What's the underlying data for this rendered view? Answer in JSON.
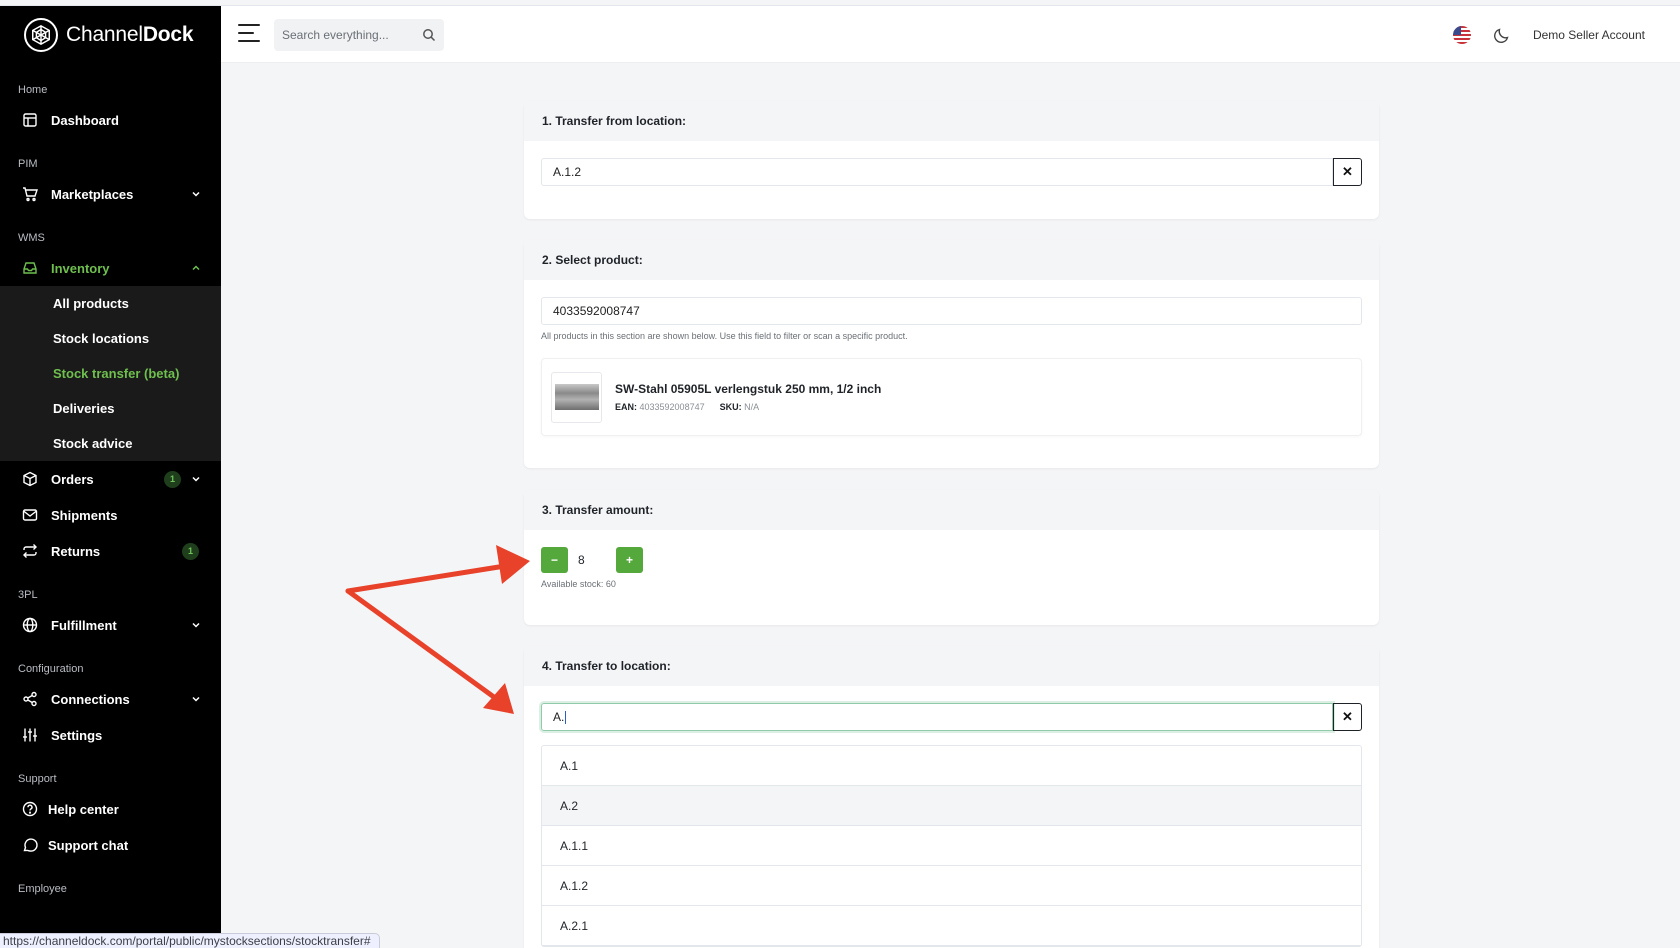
{
  "brand": {
    "name_part1": "Channel",
    "name_part2": "Dock"
  },
  "sidebar": {
    "sections": {
      "home": "Home",
      "pim": "PIM",
      "wms": "WMS",
      "tpl": "3PL",
      "config": "Configuration",
      "support": "Support",
      "employee": "Employee"
    },
    "dashboard": "Dashboard",
    "marketplaces": "Marketplaces",
    "inventory": "Inventory",
    "inventory_sub": [
      "All products",
      "Stock locations",
      "Stock transfer (beta)",
      "Deliveries",
      "Stock advice"
    ],
    "orders": "Orders",
    "orders_badge": "1",
    "shipments": "Shipments",
    "returns": "Returns",
    "returns_badge": "1",
    "fulfillment": "Fulfillment",
    "connections": "Connections",
    "settings": "Settings",
    "help_center": "Help center",
    "support_chat": "Support chat"
  },
  "header": {
    "search_placeholder": "Search everything...",
    "account": "Demo Seller Account"
  },
  "step1": {
    "title": "1. Transfer from location:",
    "value": "A.1.2",
    "clear": "✕"
  },
  "step2": {
    "title": "2. Select product:",
    "value": "4033592008747",
    "help": "All products in this section are shown below. Use this field to filter or scan a specific product.",
    "product": {
      "name": "SW-Stahl 05905L verlengstuk 250 mm, 1/2 inch",
      "ean_label": "EAN:",
      "ean": "4033592008747",
      "sku_label": "SKU:",
      "sku": "N/A"
    }
  },
  "step3": {
    "title": "3. Transfer amount:",
    "minus": "−",
    "plus": "+",
    "value": "8",
    "available": "Available stock: 60"
  },
  "step4": {
    "title": "4. Transfer to location:",
    "value": "A.",
    "clear": "✕",
    "options": [
      "A.1",
      "A.2",
      "A.1.1",
      "A.1.2",
      "A.2.1"
    ]
  },
  "statusbar": {
    "url": "https://channeldock.com/portal/public/mystocksections/stocktransfer#"
  },
  "colors": {
    "accent": "#55a83b",
    "active_nav": "#6fbf4f",
    "arrow": "#e8422b"
  }
}
